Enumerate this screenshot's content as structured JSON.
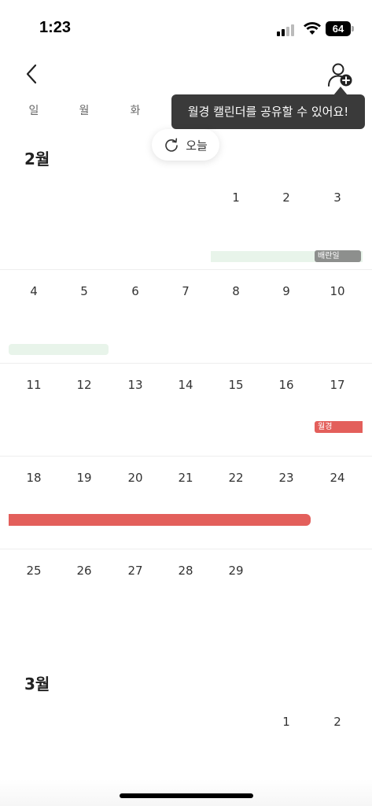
{
  "status_bar": {
    "time": "1:23",
    "battery": "64"
  },
  "header": {
    "back_icon": "chevron-left-icon",
    "share_icon": "person-add-icon",
    "tooltip": "월경 캘린더를 공유할 수 있어요!"
  },
  "weekdays": [
    "일",
    "월",
    "화"
  ],
  "today_button": {
    "label": "오늘",
    "icon": "refresh-icon"
  },
  "months": [
    {
      "title": "2월",
      "weeks": [
        [
          "",
          "",
          "",
          "",
          "1",
          "2",
          "3"
        ],
        [
          "4",
          "5",
          "6",
          "7",
          "8",
          "9",
          "10"
        ],
        [
          "11",
          "12",
          "13",
          "14",
          "15",
          "16",
          "17"
        ],
        [
          "18",
          "19",
          "20",
          "21",
          "22",
          "23",
          "24"
        ],
        [
          "25",
          "26",
          "27",
          "28",
          "29",
          "",
          ""
        ]
      ]
    },
    {
      "title": "3월",
      "weeks": [
        [
          "",
          "",
          "",
          "",
          "",
          "1",
          "2"
        ]
      ]
    }
  ],
  "events": {
    "ovulation_label": "배란일",
    "period_label": "월경"
  },
  "colors": {
    "period": "#e35f5b",
    "fertile": "#e8f4ea",
    "ovulation": "#8d8f8d",
    "tooltip_bg": "#3a3a3a"
  }
}
